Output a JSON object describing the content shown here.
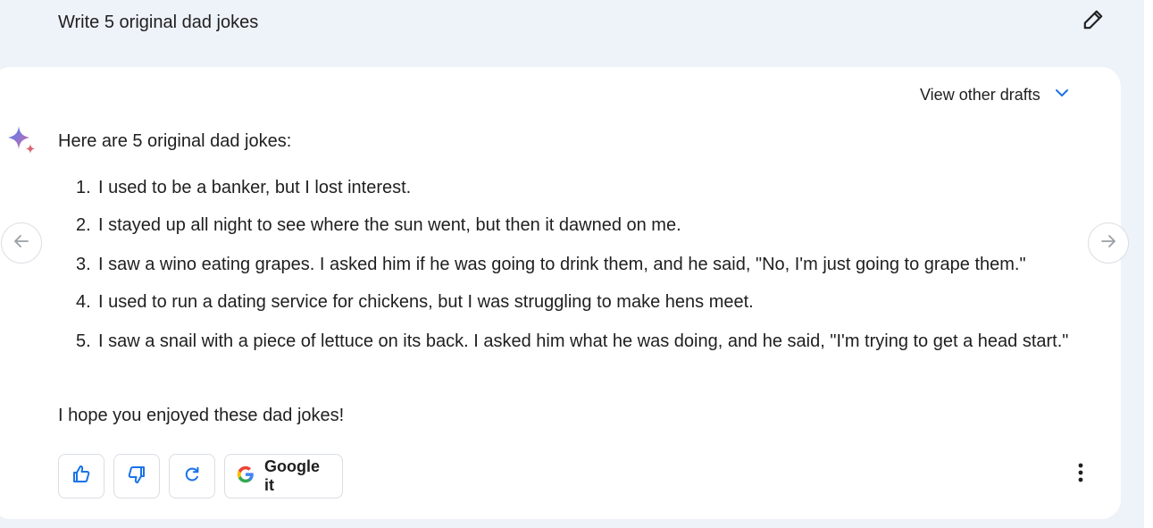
{
  "query": {
    "text": "Write 5 original dad jokes",
    "edit_icon": "pencil-icon"
  },
  "response": {
    "drafts_label": "View other drafts",
    "drafts_icon": "chevron-down-icon",
    "assistant_icon": "sparkle-icon",
    "intro": "Here are 5 original dad jokes:",
    "jokes": [
      {
        "num": "1.",
        "text": "I used to be a banker, but I lost interest."
      },
      {
        "num": "2.",
        "text": "I stayed up all night to see where the sun went, but then it dawned on me."
      },
      {
        "num": "3.",
        "text": "I saw a wino eating grapes. I asked him if he was going to drink them, and he said, \"No, I'm just going to grape them.\""
      },
      {
        "num": "4.",
        "text": "I used to run a dating service for chickens, but I was struggling to make hens meet."
      },
      {
        "num": "5.",
        "text": "I saw a snail with a piece of lettuce on its back. I asked him what he was doing, and he said, \"I'm trying to get a head start.\""
      }
    ],
    "outro": "I hope you enjoyed these dad jokes!"
  },
  "navigation": {
    "prev_icon": "arrow-left-icon",
    "next_icon": "arrow-right-icon"
  },
  "actions": {
    "thumbs_up_icon": "thumbs-up-icon",
    "thumbs_down_icon": "thumbs-down-icon",
    "regenerate_icon": "refresh-icon",
    "google_label": "Google it",
    "google_icon": "google-g-icon",
    "more_icon": "more-vertical-icon"
  },
  "colors": {
    "page_background": "#eef2f9",
    "card_background": "#ffffff",
    "accent_blue": "#1a73e8",
    "text": "#1f1f1f"
  }
}
